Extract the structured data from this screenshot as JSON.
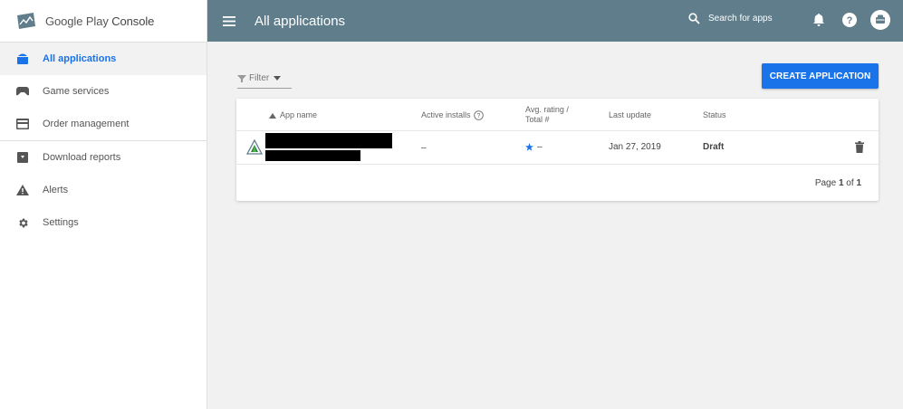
{
  "app": {
    "logo_text_light": "Google Play",
    "logo_text_bold": "Console"
  },
  "sidebar": {
    "items": [
      {
        "label": "All applications",
        "icon": "android-icon",
        "active": true
      },
      {
        "label": "Game services",
        "icon": "gamepad-icon",
        "active": false
      },
      {
        "label": "Order management",
        "icon": "credit-card-icon",
        "active": false
      },
      {
        "label": "Download reports",
        "icon": "download-box-icon",
        "active": false
      },
      {
        "label": "Alerts",
        "icon": "warning-icon",
        "active": false
      },
      {
        "label": "Settings",
        "icon": "gear-icon",
        "active": false
      }
    ]
  },
  "topbar": {
    "title": "All applications",
    "search_label": "Search for apps",
    "icons": [
      "menu-icon",
      "search-icon",
      "bell-icon",
      "help-icon",
      "account-icon"
    ]
  },
  "toolbar": {
    "filter_label": "Filter",
    "create_label": "CREATE APPLICATION"
  },
  "table": {
    "headers": {
      "app_name": "App name",
      "active_installs": "Active installs",
      "avg_rating_line1": "Avg. rating /",
      "avg_rating_line2": "Total #",
      "last_update": "Last update",
      "status": "Status"
    },
    "rows": [
      {
        "active_installs": "–",
        "rating": "–",
        "last_update": "Jan 27, 2019",
        "status": "Draft"
      }
    ],
    "pagination": {
      "prefix": "Page ",
      "current": "1",
      "middle": " of ",
      "total": "1"
    }
  },
  "colors": {
    "topbar": "#607d8b",
    "accent": "#1a73e8",
    "sidebar_bg": "#ffffff",
    "page_bg": "#f1f1f1"
  }
}
